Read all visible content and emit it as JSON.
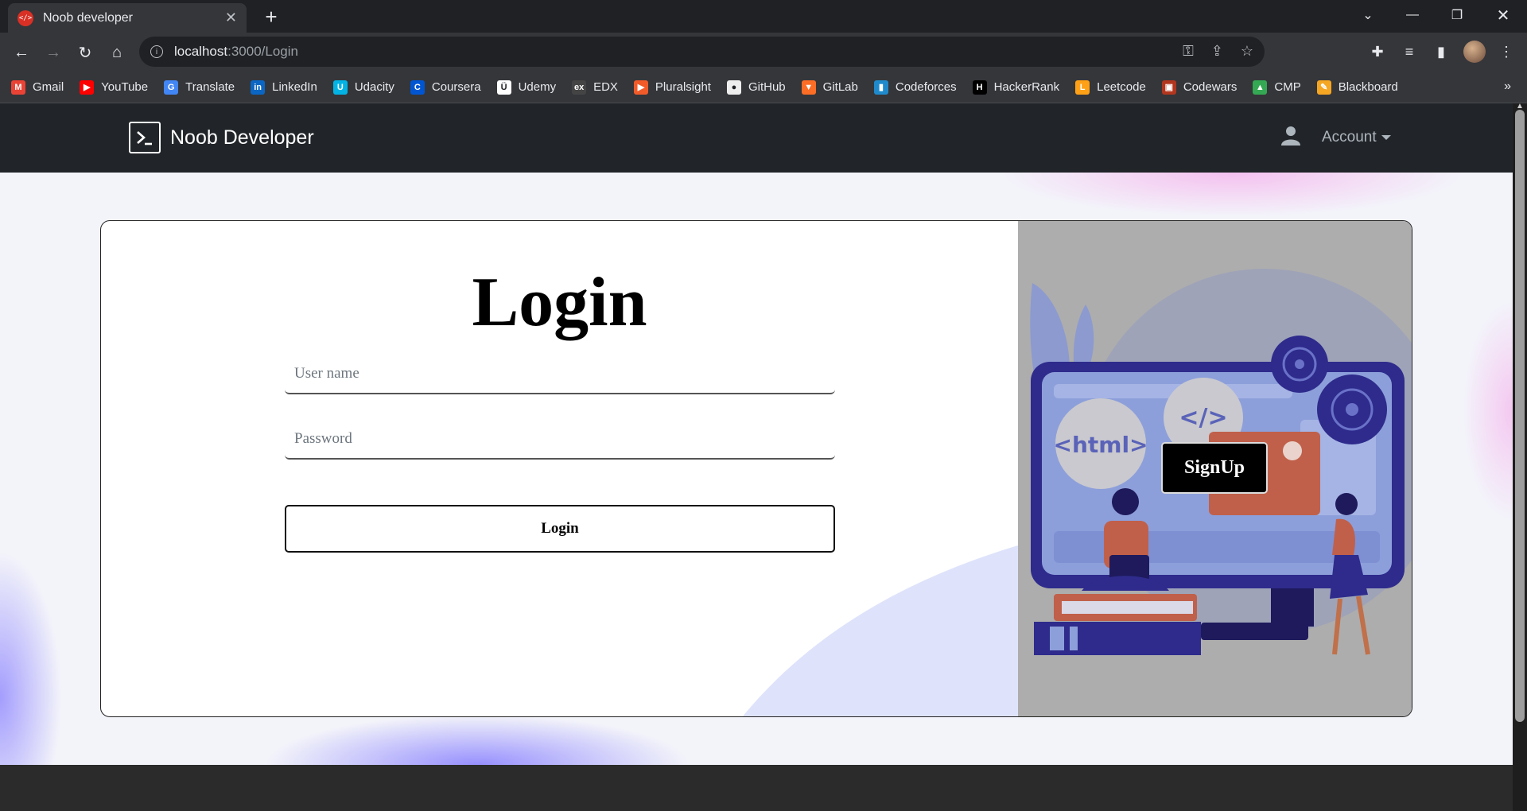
{
  "browser": {
    "tab_title": "Noob developer",
    "tab_favicon": "</>",
    "url_host": "localhost",
    "url_path": ":3000/Login",
    "bookmarks": [
      {
        "label": "Gmail",
        "icon": "gmail-icon",
        "color": "#ea4335",
        "glyph": "M"
      },
      {
        "label": "YouTube",
        "icon": "youtube-icon",
        "color": "#ff0000",
        "glyph": "▶"
      },
      {
        "label": "Translate",
        "icon": "translate-icon",
        "color": "#4285f4",
        "glyph": "G"
      },
      {
        "label": "LinkedIn",
        "icon": "linkedin-icon",
        "color": "#0a66c2",
        "glyph": "in"
      },
      {
        "label": "Udacity",
        "icon": "udacity-icon",
        "color": "#02b3e4",
        "glyph": "U"
      },
      {
        "label": "Coursera",
        "icon": "coursera-icon",
        "color": "#0056d2",
        "glyph": "C"
      },
      {
        "label": "Udemy",
        "icon": "udemy-icon",
        "color": "#ffffff",
        "glyph": "Ü"
      },
      {
        "label": "EDX",
        "icon": "edx-icon",
        "color": "#444444",
        "glyph": "ex"
      },
      {
        "label": "Pluralsight",
        "icon": "pluralsight-icon",
        "color": "#f15b2a",
        "glyph": "▶"
      },
      {
        "label": "GitHub",
        "icon": "github-icon",
        "color": "#eeeeee",
        "glyph": "●"
      },
      {
        "label": "GitLab",
        "icon": "gitlab-icon",
        "color": "#fc6d26",
        "glyph": "▼"
      },
      {
        "label": "Codeforces",
        "icon": "codeforces-icon",
        "color": "#1f8acb",
        "glyph": "▮"
      },
      {
        "label": "HackerRank",
        "icon": "hackerrank-icon",
        "color": "#000000",
        "glyph": "H"
      },
      {
        "label": "Leetcode",
        "icon": "leetcode-icon",
        "color": "#ffa116",
        "glyph": "L"
      },
      {
        "label": "Codewars",
        "icon": "codewars-icon",
        "color": "#b1361e",
        "glyph": "▣"
      },
      {
        "label": "CMP",
        "icon": "google-drive-icon",
        "color": "#34a853",
        "glyph": "▲"
      },
      {
        "label": "Blackboard",
        "icon": "blackboard-icon",
        "color": "#f5a623",
        "glyph": "✎"
      }
    ]
  },
  "nav": {
    "brand": "Noob Developer",
    "account_label": "Account"
  },
  "login": {
    "title": "Login",
    "username_placeholder": "User name",
    "password_placeholder": "Password",
    "submit_label": "Login"
  },
  "illustration": {
    "signup_label": "SignUp",
    "html_tag": "<html>",
    "code_tag": "</>"
  }
}
